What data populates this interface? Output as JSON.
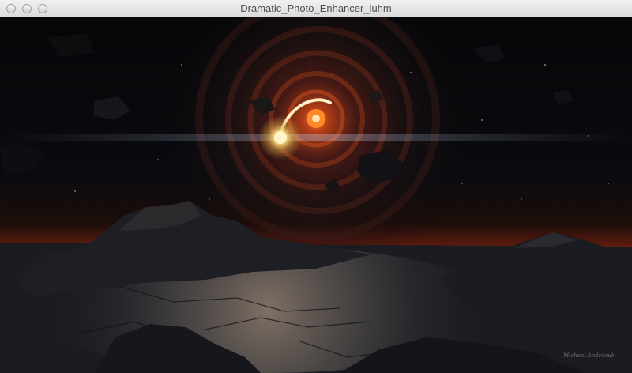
{
  "window": {
    "title": "Dramatic_Photo_Enhancer_luhm"
  },
  "controls": {
    "close_icon": "close-icon",
    "minimize_icon": "minimize-icon",
    "zoom_icon": "zoom-icon"
  },
  "image": {
    "signature": "Michael Andreeuk"
  },
  "colors": {
    "horizon_glow": "#b8351c",
    "accretion_core": "#ff6a1a",
    "star_glow": "#ffe08a",
    "terrain": "#1a1c22"
  }
}
